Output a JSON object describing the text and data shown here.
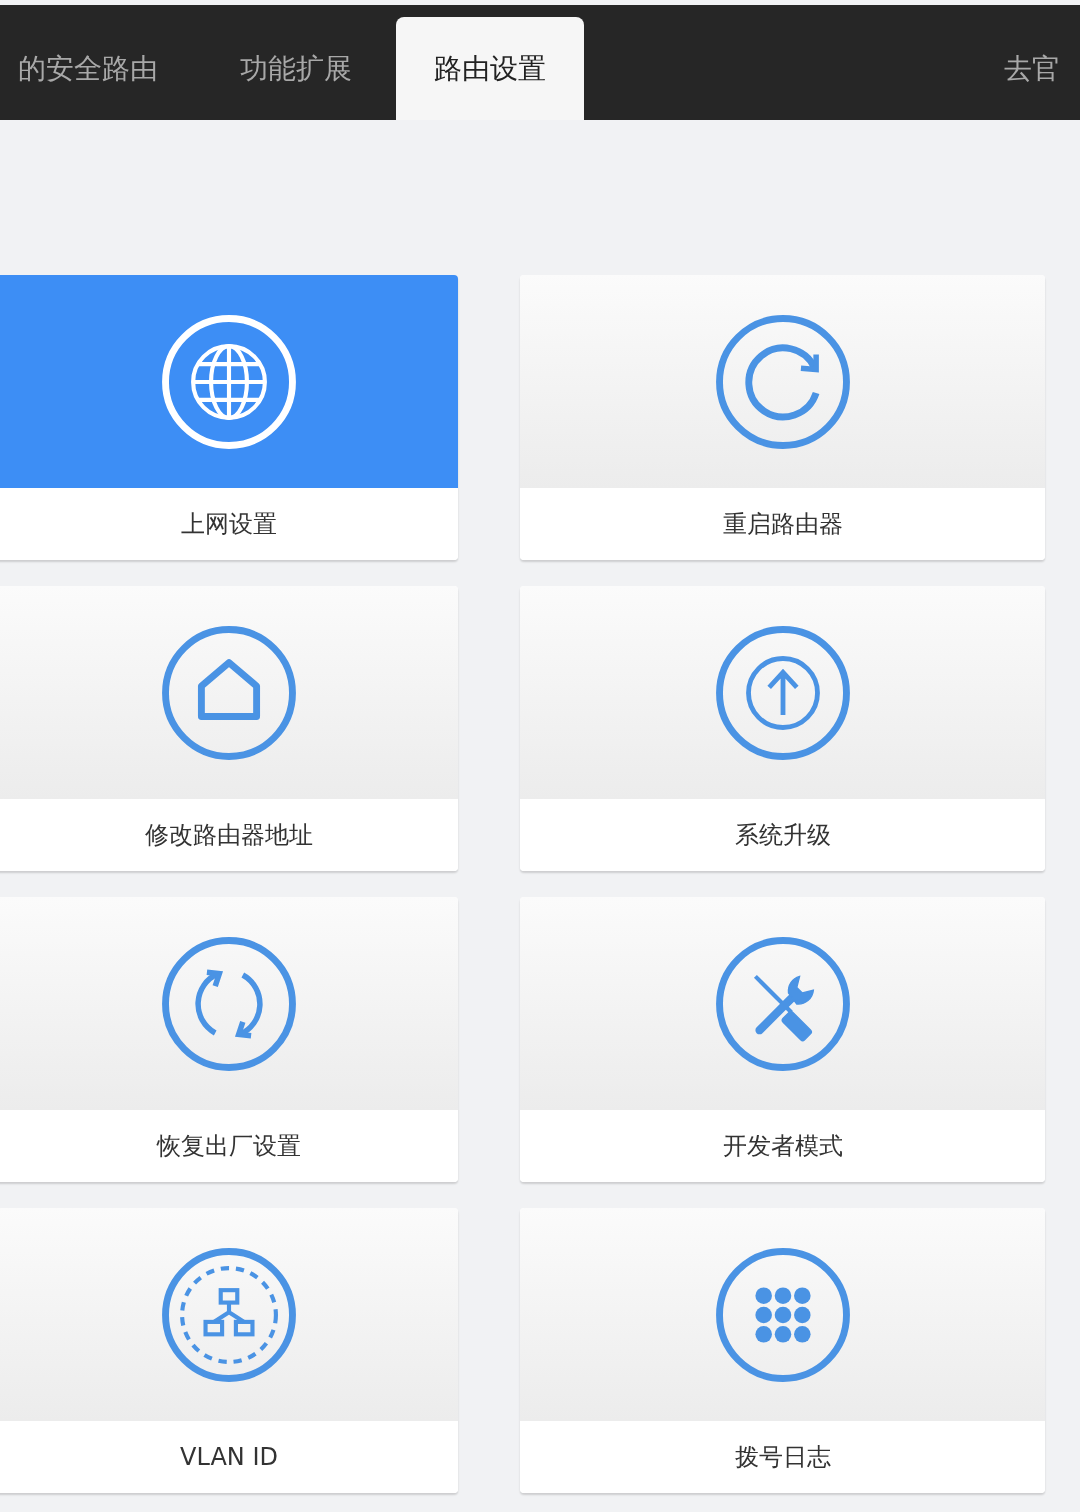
{
  "tabs": [
    {
      "label": "的安全路由",
      "selected": false
    },
    {
      "label": "功能扩展",
      "selected": false
    },
    {
      "label": "路由设置",
      "selected": true
    },
    {
      "label": "去官",
      "selected": false
    }
  ],
  "tiles": [
    {
      "label": "上网设置",
      "selected": true
    },
    {
      "label": "重启路由器",
      "selected": false
    },
    {
      "label": "修改路由器地址",
      "selected": false
    },
    {
      "label": "系统升级",
      "selected": false
    },
    {
      "label": "恢复出厂设置",
      "selected": false
    },
    {
      "label": "开发者模式",
      "selected": false
    },
    {
      "label": "VLAN ID",
      "selected": false
    },
    {
      "label": "拨号日志",
      "selected": false
    }
  ]
}
